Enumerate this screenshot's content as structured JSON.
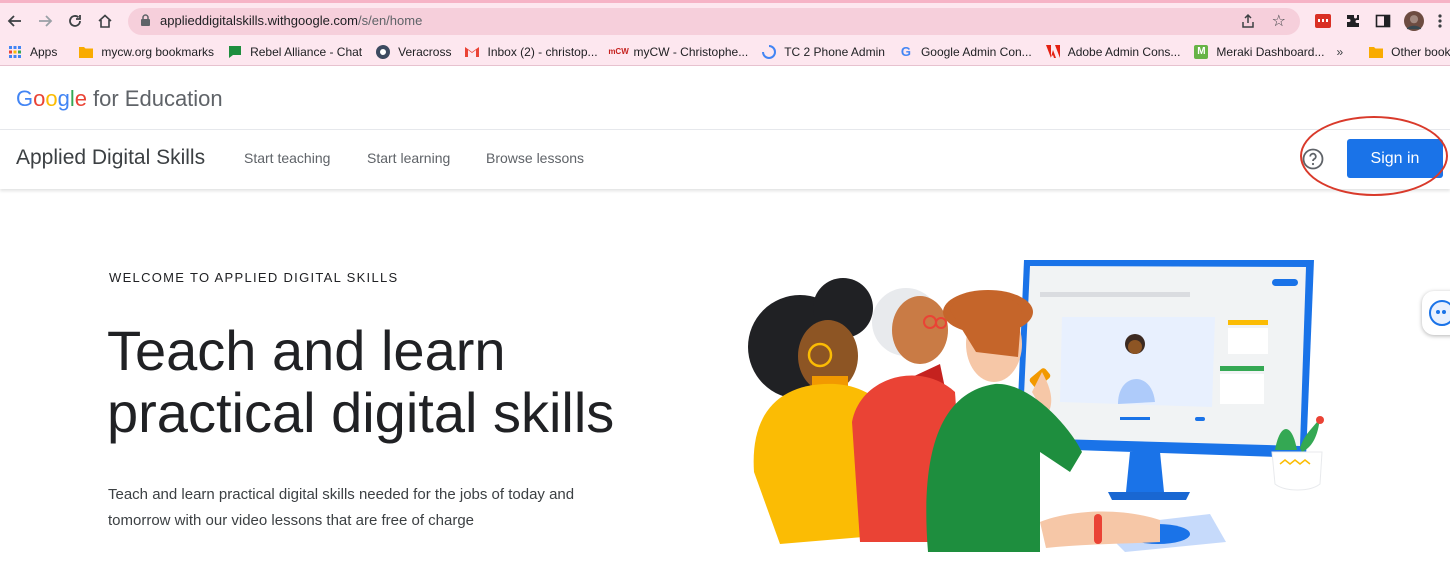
{
  "browser": {
    "url_host": "applieddigitalskills.withgoogle.com",
    "url_path": "/s/en/home"
  },
  "bookmarks": [
    {
      "label": "Apps",
      "icon": "apps-grid-icon",
      "color": "#4285f4"
    },
    {
      "label": "mycw.org bookmarks",
      "icon": "folder-icon",
      "color": "#f9ab00"
    },
    {
      "label": "Rebel Alliance - Chat",
      "icon": "chat-icon",
      "color": "#1e8e3e"
    },
    {
      "label": "Veracross",
      "icon": "veracross-icon",
      "color": "#3c4a60"
    },
    {
      "label": "Inbox (2) - christop...",
      "icon": "gmail-icon",
      "color": "#ea4335"
    },
    {
      "label": "mCW",
      "icon": "mycw-icon",
      "color": "#c5221f"
    },
    {
      "label": "myCW - Christophe...",
      "icon": "",
      "color": ""
    },
    {
      "label": "TC 2 Phone Admin",
      "icon": "loading-icon",
      "color": "#4285f4"
    },
    {
      "label": "Google Admin Con...",
      "icon": "google-icon",
      "color": "#4285f4"
    },
    {
      "label": "Adobe Admin Cons...",
      "icon": "adobe-icon",
      "color": "#e42012"
    },
    {
      "label": "Meraki Dashboard...",
      "icon": "meraki-icon",
      "color": "#67b346"
    }
  ],
  "bookmarks_more": "»",
  "bookmarks_other": "Other bookmarks",
  "header": {
    "brand": "Google",
    "brand_suffix": "for Education"
  },
  "site_nav": {
    "title": "Applied Digital Skills",
    "links": [
      "Start teaching",
      "Start learning",
      "Browse lessons"
    ],
    "signin_label": "Sign in"
  },
  "hero": {
    "eyebrow": "WELCOME TO APPLIED DIGITAL SKILLS",
    "title_line1": "Teach and learn",
    "title_line2": "practical digital skills",
    "description": "Teach and learn practical digital skills needed for the jobs of today and tomorrow with our video lessons that are free of charge"
  },
  "colors": {
    "accent": "#1a73e8",
    "annotation": "#d93a2b",
    "chrome": "#fde7ef"
  }
}
